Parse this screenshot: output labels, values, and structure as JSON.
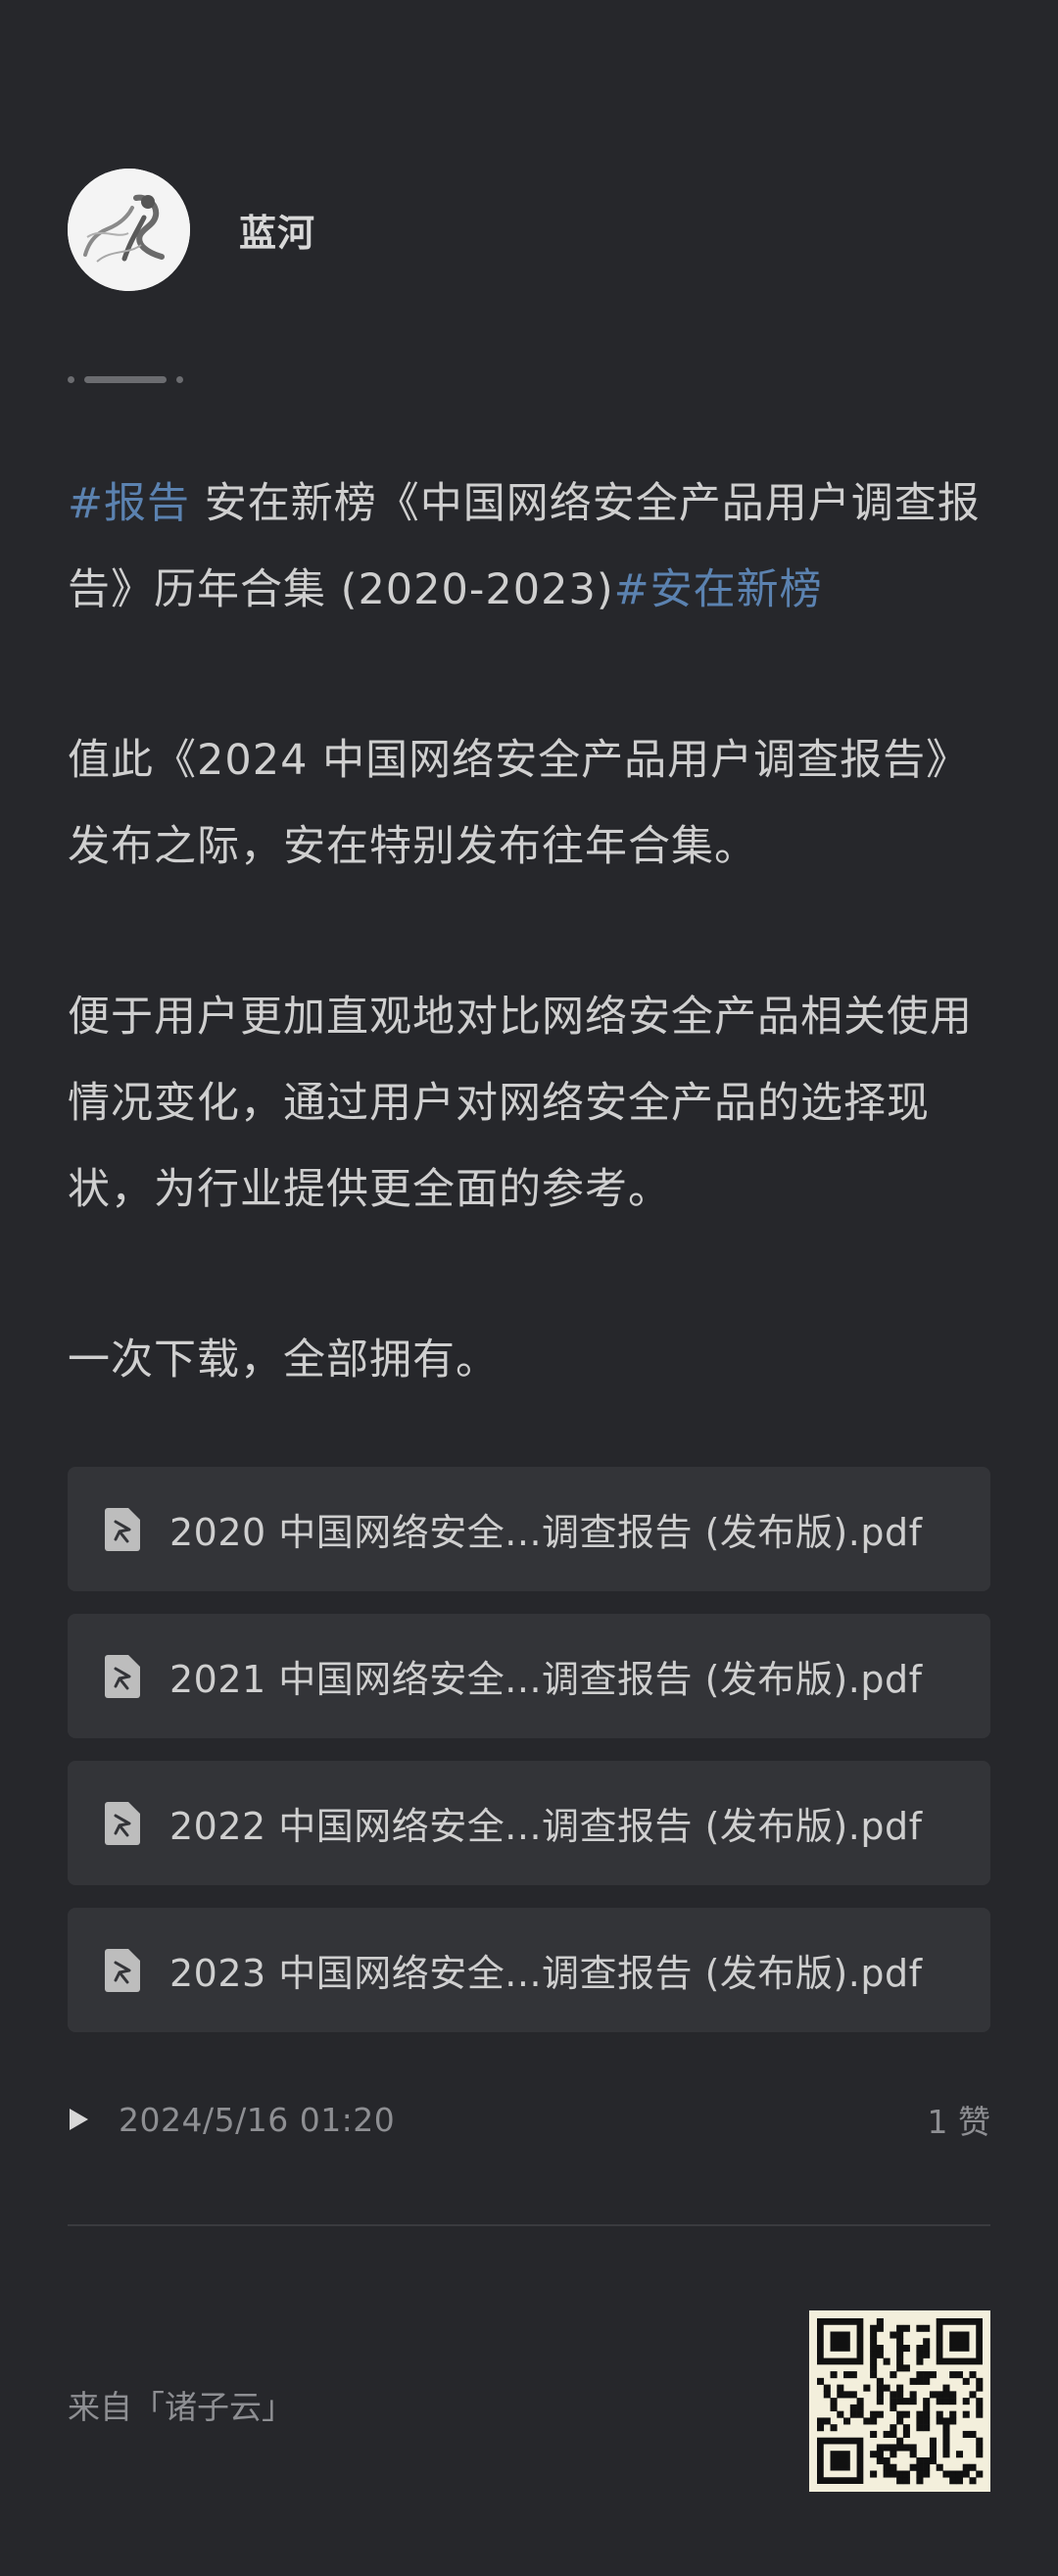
{
  "author": {
    "name": "蓝河"
  },
  "post": {
    "line1_tag": "#报告",
    "line1_text": " 安在新榜《中国网络安全产品用户调查报告》历年合集 (2020-2023)",
    "line1_tag2": "#安在新榜",
    "para2": "值此《2024 中国网络安全产品用户调查报告》发布之际，安在特别发布往年合集。",
    "para3": "便于用户更加直观地对比网络安全产品相关使用情况变化，通过用户对网络安全产品的选择现状，为行业提供更全面的参考。",
    "para4": "一次下载，全部拥有。"
  },
  "files": [
    {
      "name": "2020 中国网络安全...调查报告 (发布版).pdf",
      "icon": "pdf-icon"
    },
    {
      "name": "2021 中国网络安全...调查报告 (发布版).pdf",
      "icon": "pdf-icon"
    },
    {
      "name": "2022 中国网络安全...调查报告 (发布版).pdf",
      "icon": "pdf-icon"
    },
    {
      "name": "2023 中国网络安全...调查报告 (发布版).pdf",
      "icon": "pdf-icon"
    }
  ],
  "meta": {
    "timestamp": "2024/5/16 01:20",
    "likes": "1 赞",
    "play_icon": "play-icon"
  },
  "footer": {
    "source": "来自「诸子云」",
    "qr_icon": "qr-code"
  },
  "colors": {
    "background": "#26272b",
    "card": "#333438",
    "text": "#cfcfcf",
    "muted": "#8e8f93",
    "tag": "#5b82b0"
  }
}
